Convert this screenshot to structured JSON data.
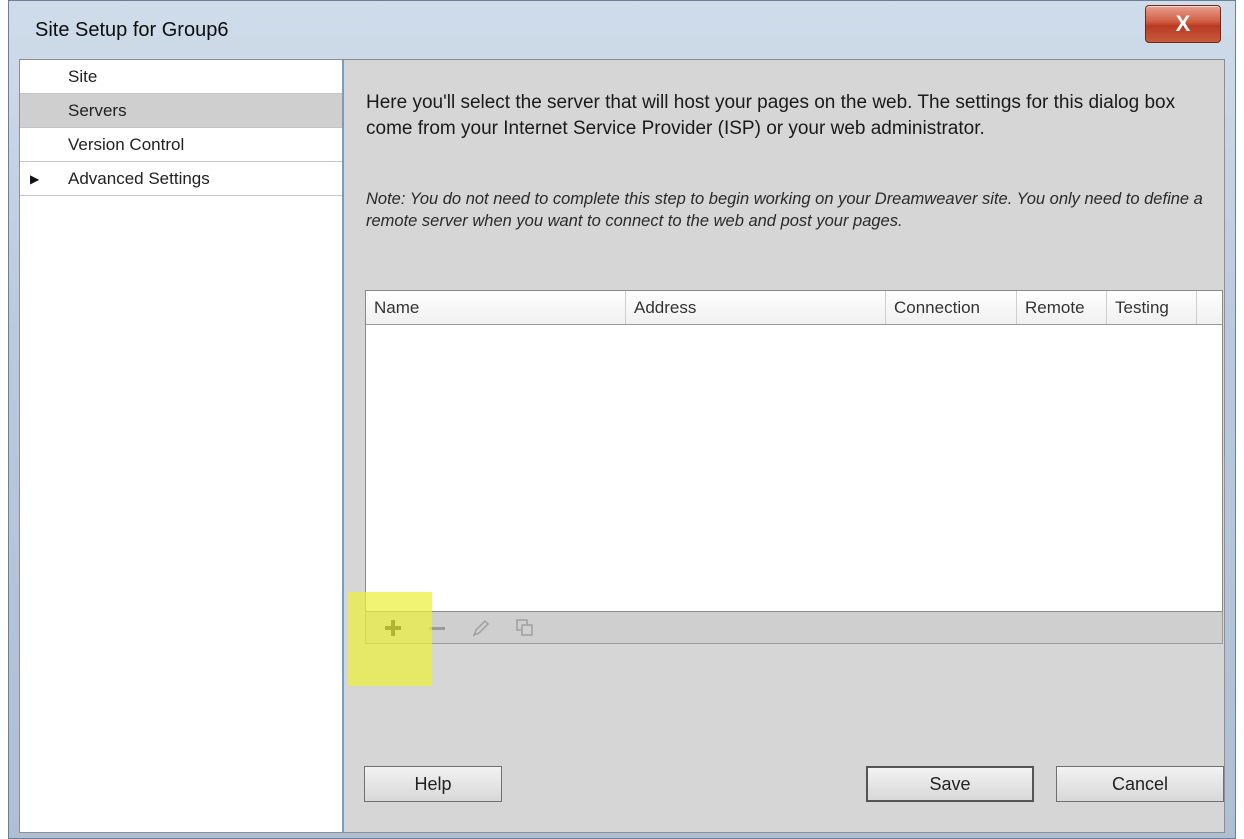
{
  "window": {
    "title": "Site Setup for Group6",
    "close_label": "X"
  },
  "sidebar": {
    "items": [
      {
        "label": "Site"
      },
      {
        "label": "Servers"
      },
      {
        "label": "Version Control"
      },
      {
        "label": "Advanced Settings"
      }
    ],
    "selected": "Servers"
  },
  "main": {
    "intro": "Here you'll select the server that will host your pages on the web. The settings for this dialog box come from your Internet Service Provider (ISP) or your web administrator.",
    "note": "Note: You do not need to complete this step to begin working on your Dreamweaver site. You only need to define a remote server when you want to connect to the web and post your pages."
  },
  "table": {
    "columns": [
      "Name",
      "Address",
      "Connection",
      "Remote",
      "Testing"
    ],
    "rows": []
  },
  "toolbar": {
    "icons": [
      "add-icon",
      "remove-icon",
      "edit-icon",
      "duplicate-icon"
    ]
  },
  "buttons": {
    "help": "Help",
    "save": "Save",
    "cancel": "Cancel"
  },
  "colors": {
    "highlight": "#ecf03c",
    "close_button": "#c8482e",
    "sidebar_selected": "#cfcfcf"
  }
}
